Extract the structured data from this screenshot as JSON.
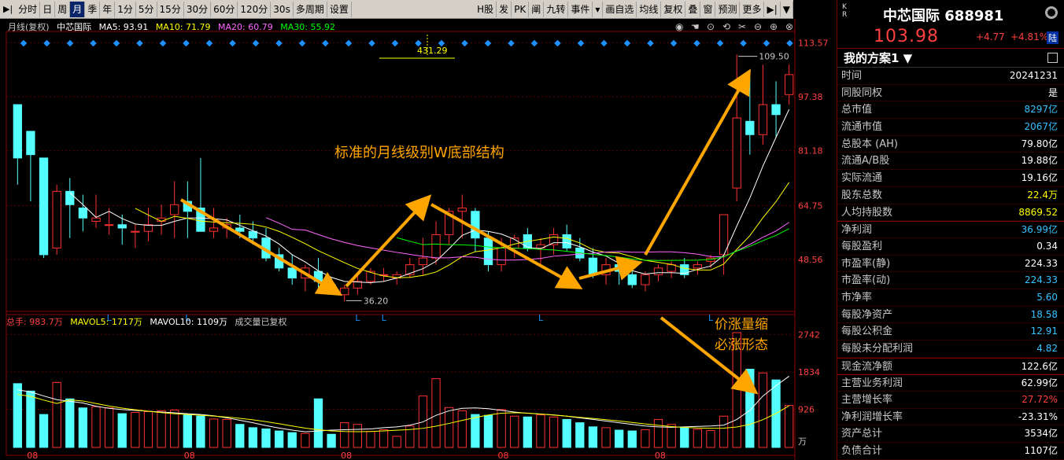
{
  "toolbar": {
    "items": [
      "分时",
      "日",
      "周",
      "月",
      "季",
      "年",
      "1分",
      "5分",
      "15分",
      "30分",
      "60分",
      "120分",
      "30s",
      "多周期",
      "设置"
    ],
    "active_index": 3,
    "right_items": [
      "H股",
      "发",
      "PK",
      "阐",
      "九转",
      "事件",
      "",
      "画自选",
      "均线",
      "复权",
      "叠",
      "窗",
      "预测",
      "更多"
    ]
  },
  "legend": {
    "period": "月线(复权)",
    "name": "中芯国际",
    "ma5": "MA5: 93.91",
    "ma10": "MA10: 71.79",
    "ma20": "MA20: 60.79",
    "ma30": "MA30: 55.92",
    "vol_total": "总手: 983.7万",
    "mavol5": "MAVOL5: 1717万",
    "mavol10": "MAVOL10: 1109万",
    "vol_note": "成交量已复权"
  },
  "chart_data": {
    "type": "candlestick",
    "price_axis": [
      "113.57",
      "97.38",
      "81.18",
      "64.75",
      "48.56"
    ],
    "volume_axis": [
      "2742",
      "1834",
      "926"
    ],
    "volume_unit": "万",
    "x_ticks": [
      "08",
      "08",
      "08",
      "08",
      "08"
    ],
    "annotations": {
      "peak_label": "431.29",
      "high_label": "109.50",
      "low_label": "36.20",
      "title_note": "标准的月线级别W底部结构",
      "vol_note_1": "价涨量缩",
      "vol_note_2": "必涨形态",
      "l_marker": "L"
    },
    "ohlc": [
      [
        95,
        95,
        71,
        79
      ],
      [
        87,
        87,
        66,
        80
      ],
      [
        79,
        79,
        49,
        50
      ],
      [
        52,
        71,
        50,
        69
      ],
      [
        69,
        73,
        55,
        65
      ],
      [
        64,
        68,
        57,
        61
      ],
      [
        60,
        68,
        58,
        61
      ],
      [
        59,
        64,
        56,
        59
      ],
      [
        59,
        62,
        53,
        58
      ],
      [
        57,
        59,
        52,
        57
      ],
      [
        57,
        64,
        54,
        59
      ],
      [
        60,
        65,
        56,
        61
      ],
      [
        62,
        72,
        55,
        65
      ],
      [
        66,
        72,
        55,
        63
      ],
      [
        64,
        79,
        58,
        57
      ],
      [
        57,
        64,
        55,
        58
      ],
      [
        58,
        61,
        55,
        59
      ],
      [
        58,
        62,
        55,
        57
      ],
      [
        57,
        60,
        53,
        55
      ],
      [
        55,
        58,
        48,
        49
      ],
      [
        50,
        52,
        45,
        46
      ],
      [
        46,
        50,
        41,
        43
      ],
      [
        43,
        47,
        39,
        46
      ],
      [
        45,
        49,
        39,
        42
      ],
      [
        41,
        43,
        38,
        39
      ],
      [
        38,
        41,
        36,
        40
      ],
      [
        40,
        44,
        38,
        42
      ],
      [
        42,
        46,
        41,
        45
      ],
      [
        44,
        46,
        42,
        44
      ],
      [
        43,
        45,
        41,
        44
      ],
      [
        44,
        49,
        43,
        47
      ],
      [
        47,
        55,
        44,
        49
      ],
      [
        49,
        60,
        47,
        56
      ],
      [
        56,
        64,
        53,
        63
      ],
      [
        63,
        68,
        55,
        64
      ],
      [
        63,
        64,
        51,
        55
      ],
      [
        55,
        57,
        45,
        47
      ],
      [
        47,
        55,
        45,
        52
      ],
      [
        52,
        56,
        49,
        55
      ],
      [
        56,
        58,
        51,
        52
      ],
      [
        52,
        55,
        47,
        53
      ],
      [
        53,
        58,
        50,
        56
      ],
      [
        56,
        59,
        51,
        52
      ],
      [
        52,
        55,
        48,
        49
      ],
      [
        49,
        52,
        43,
        44
      ],
      [
        44,
        49,
        41,
        47
      ],
      [
        47,
        49,
        41,
        45
      ],
      [
        44,
        47,
        40,
        41
      ],
      [
        41,
        45,
        39,
        44
      ],
      [
        44,
        47,
        42,
        46
      ],
      [
        45,
        48,
        43,
        47
      ],
      [
        47,
        49,
        43,
        44
      ],
      [
        46,
        48,
        44,
        47
      ],
      [
        48,
        50,
        46,
        49
      ],
      [
        50,
        62,
        44,
        62
      ],
      [
        70,
        110,
        66,
        91
      ],
      [
        90,
        105,
        80,
        86
      ],
      [
        86,
        107,
        83,
        95
      ],
      [
        95,
        102,
        85,
        92
      ],
      [
        98,
        107,
        95,
        104
      ]
    ],
    "volume": [
      1550,
      1370,
      800,
      1580,
      1180,
      960,
      990,
      960,
      820,
      850,
      870,
      890,
      910,
      790,
      760,
      690,
      680,
      560,
      480,
      450,
      400,
      360,
      340,
      1180,
      320,
      600,
      560,
      390,
      430,
      270,
      520,
      1250,
      1670,
      970,
      890,
      800,
      780,
      920,
      760,
      740,
      790,
      740,
      680,
      600,
      500,
      480,
      420,
      400,
      430,
      680,
      560,
      480,
      440,
      410,
      760,
      2790,
      1900,
      1810,
      1640,
      1020
    ],
    "ma5_vol": [
      1400,
      1350,
      1250,
      1160,
      1120,
      1080,
      1000,
      950,
      920,
      900,
      880,
      860,
      840,
      820,
      800,
      770,
      720,
      660,
      600,
      530,
      470,
      420,
      380,
      400,
      420,
      430,
      440,
      450,
      480,
      500,
      540,
      620,
      780,
      890,
      950,
      960,
      940,
      900,
      860,
      830,
      810,
      790,
      760,
      720,
      680,
      640,
      600,
      560,
      520,
      500,
      490,
      500,
      510,
      520,
      540,
      680,
      900,
      1250,
      1500,
      1730
    ]
  },
  "panel": {
    "kr": "K R",
    "title": "中芯国际 688981",
    "price": "103.98",
    "change": "+4.77",
    "change_pct": "+4.81%",
    "board": "陆",
    "plan": "我的方案1 ▼",
    "rows": [
      {
        "k": "时间",
        "v": "20241231",
        "c": "#ffffff"
      },
      {
        "k": "同股同权",
        "v": "是",
        "c": "#ffffff"
      },
      {
        "k": "总市值",
        "v": "8297亿",
        "c": "#37c2ff"
      },
      {
        "k": "流通市值",
        "v": "2067亿",
        "c": "#37c2ff"
      },
      {
        "k": "总股本 (AH)",
        "v": "79.80亿",
        "c": "#ffffff"
      },
      {
        "k": "流通A/B股",
        "v": "19.88亿",
        "c": "#ffffff"
      },
      {
        "k": "实际流通",
        "v": "19.16亿",
        "c": "#ffffff"
      },
      {
        "k": "股东总数",
        "v": "22.4万",
        "c": "#ffff00"
      },
      {
        "k": "人均持股数",
        "v": "8869.52",
        "c": "#ffff00"
      },
      {
        "k": "净利润",
        "v": "36.99亿",
        "c": "#37c2ff"
      },
      {
        "k": "每股盈利",
        "v": "0.34",
        "c": "#ffffff"
      },
      {
        "k": "市盈率(静)",
        "v": "224.33",
        "c": "#ffffff"
      },
      {
        "k": "市盈率(动)",
        "v": "224.33",
        "c": "#37c2ff"
      },
      {
        "k": "市净率",
        "v": "5.60",
        "c": "#37c2ff"
      },
      {
        "k": "每股净资产",
        "v": "18.58",
        "c": "#37c2ff"
      },
      {
        "k": "每股公积金",
        "v": "12.91",
        "c": "#37c2ff"
      },
      {
        "k": "每股未分配利润",
        "v": "4.82",
        "c": "#37c2ff"
      },
      {
        "k": "现金流净额",
        "v": "122.6亿",
        "c": "#ffffff"
      },
      {
        "k": "主营业务利润",
        "v": "62.99亿",
        "c": "#ffffff"
      },
      {
        "k": "主营增长率",
        "v": "27.72%",
        "c": "#ff4040"
      },
      {
        "k": "净利润增长率",
        "v": "-23.31%",
        "c": "#ffffff"
      },
      {
        "k": "资产总计",
        "v": "3534亿",
        "c": "#ffffff"
      },
      {
        "k": "负债合计",
        "v": "1107亿",
        "c": "#ffffff"
      }
    ]
  }
}
